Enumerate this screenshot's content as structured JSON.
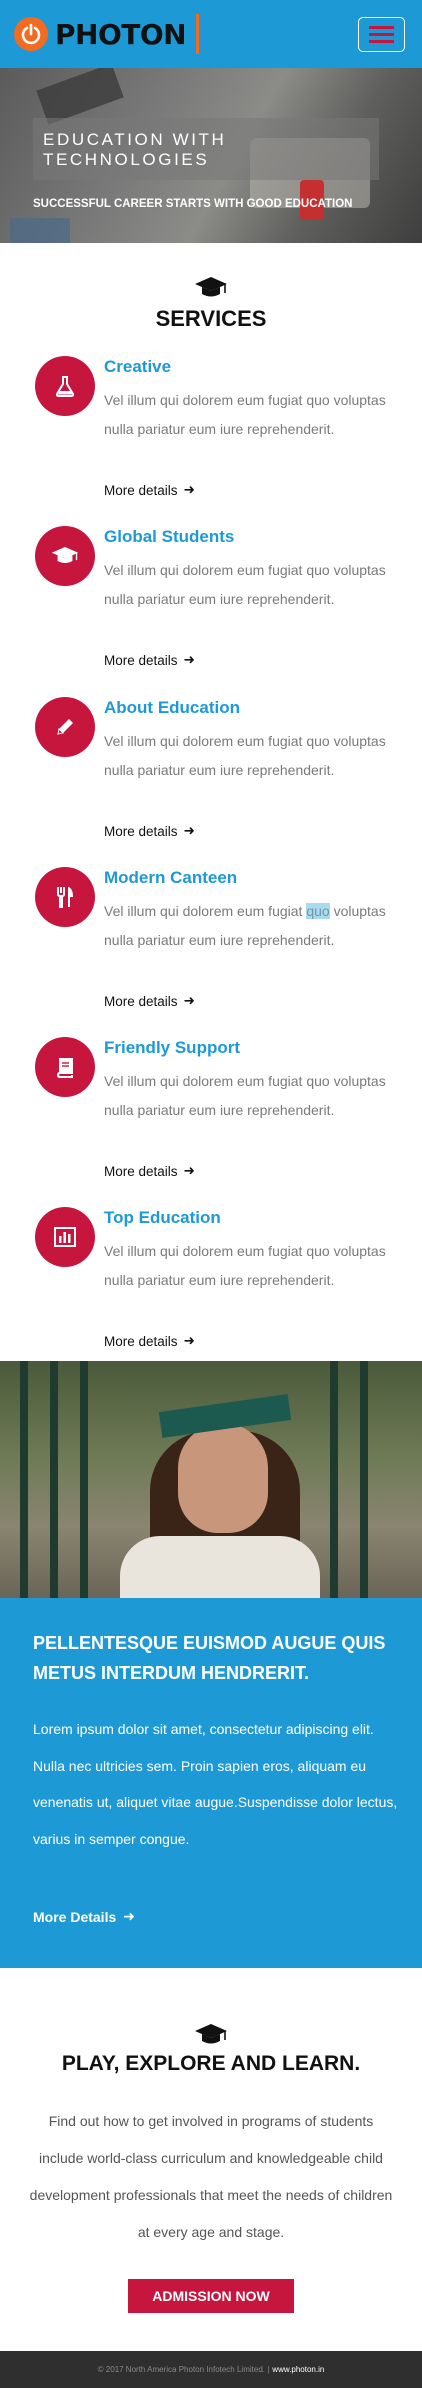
{
  "header": {
    "logo_text": "PHOTON",
    "brand_color": "#1d9ad6",
    "accent_color": "#f26b21",
    "menu_icon": "hamburger-icon"
  },
  "hero": {
    "title_line1": "EDUCATION WITH",
    "title_line2": "TECHNOLOGIES",
    "subtitle": "SUCCESSFUL CAREER STARTS WITH GOOD EDUCATION"
  },
  "services": {
    "icon": "graduation-cap-icon",
    "title": "SERVICES",
    "circle_color": "#c6163e",
    "items": [
      {
        "title": "Creative",
        "icon": "flask-icon",
        "text": "Vel illum qui dolorem eum fugiat quo voluptas nulla pariatur eum iure reprehenderit.",
        "more": "More details"
      },
      {
        "title": "Global Students",
        "icon": "graduation-cap-icon",
        "text": "Vel illum qui dolorem eum fugiat quo voluptas nulla pariatur eum iure reprehenderit.",
        "more": "More details"
      },
      {
        "title": "About Education",
        "icon": "pencil-icon",
        "text": "Vel illum qui dolorem eum fugiat quo voluptas nulla pariatur eum iure reprehenderit.",
        "more": "More details"
      },
      {
        "title": "Modern Canteen",
        "icon": "cutlery-icon",
        "text_before": "Vel illum qui dolorem eum fugiat ",
        "text_highlight": "quo",
        "text_after": " voluptas nulla pariatur eum iure reprehenderit.",
        "more": "More details"
      },
      {
        "title": "Friendly Support",
        "icon": "book-icon",
        "text": "Vel illum qui dolorem eum fugiat quo voluptas nulla pariatur eum iure reprehenderit.",
        "more": "More details"
      },
      {
        "title": "Top Education",
        "icon": "bar-chart-icon",
        "text": "Vel illum qui dolorem eum fugiat quo voluptas nulla pariatur eum iure reprehenderit.",
        "more": "More details"
      }
    ]
  },
  "feature": {
    "title": "PELLENTESQUE EUISMOD AUGUE QUIS METUS INTERDUM HENDRERIT.",
    "text": "Lorem ipsum dolor sit amet, consectetur adipiscing elit. Nulla nec ultricies sem. Proin sapien eros, aliquam eu venenatis ut, aliquet vitae augue.Suspendisse dolor lectus, varius in semper congue.",
    "more": "More Details"
  },
  "play": {
    "icon": "graduation-cap-icon",
    "title": "PLAY, EXPLORE AND LEARN.",
    "text": "Find out how to get involved in programs of students include world-class curriculum and knowledgeable child development professionals that meet the needs of children at every age and stage.",
    "button": "ADMISSION NOW"
  },
  "footer": {
    "copyright": "© 2017 North America Photon Infotech Limited. |",
    "site": "www.photon.in"
  }
}
